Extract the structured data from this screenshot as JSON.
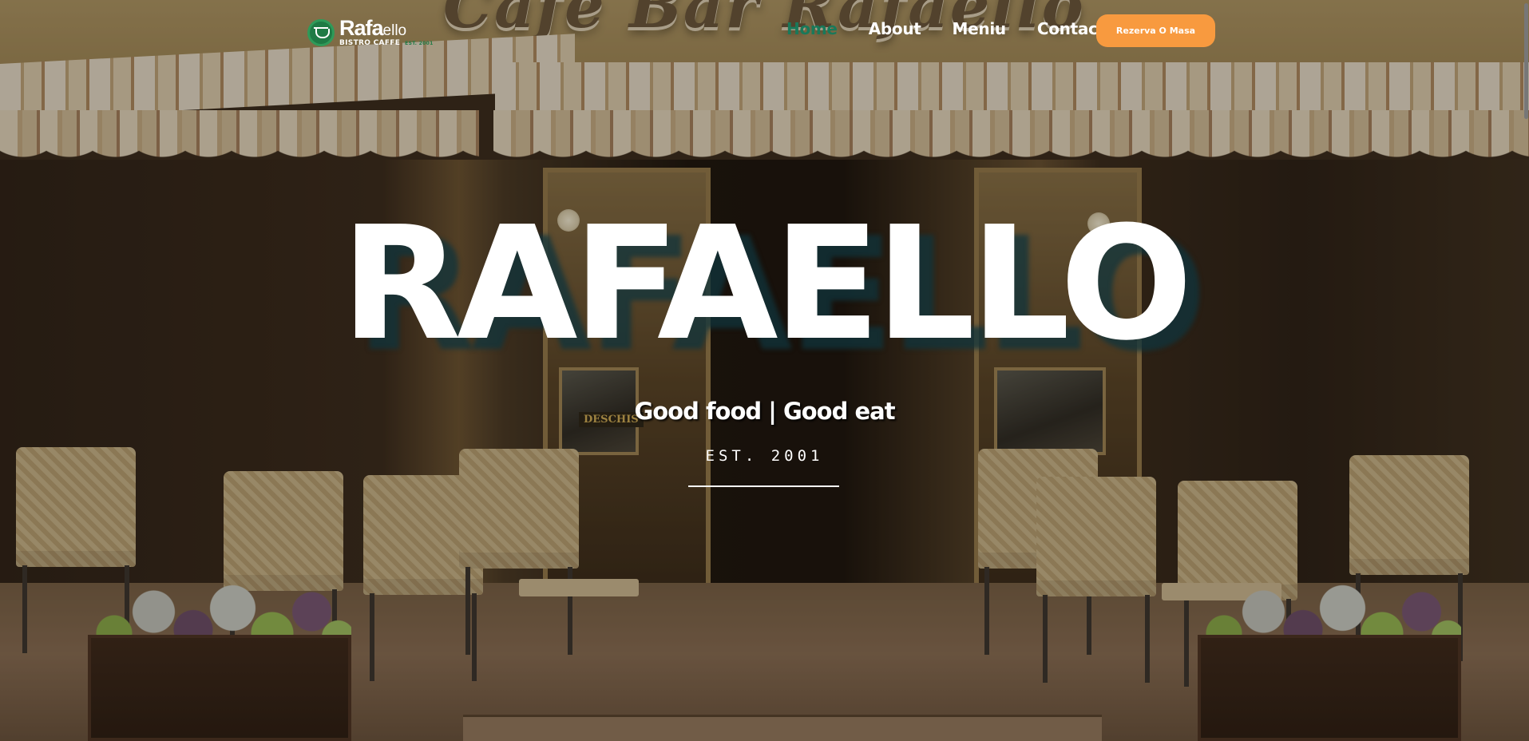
{
  "header": {
    "logo": {
      "main": "Rafa",
      "main_suffix": "ello",
      "sub": "BISTRO CAFFE",
      "tag": "EST. 2001"
    },
    "nav": [
      {
        "label": "Home",
        "active": true
      },
      {
        "label": "About",
        "active": false
      },
      {
        "label": "Meniu",
        "active": false
      },
      {
        "label": "Contact",
        "active": false
      }
    ],
    "cta_label": "Rezerva O Masa"
  },
  "hero": {
    "title": "RAFAELLO",
    "subtitle": "Good food | Good eat",
    "est": "EST. 2001"
  },
  "background": {
    "sign_text": "Cafe Bar Rafaello",
    "door_sign": "DESCHIS"
  },
  "colors": {
    "accent_orange": "#f89a3f",
    "brand_green": "#1f7a45",
    "active_nav": "#19795a",
    "hero_shadow": "#10343c"
  }
}
